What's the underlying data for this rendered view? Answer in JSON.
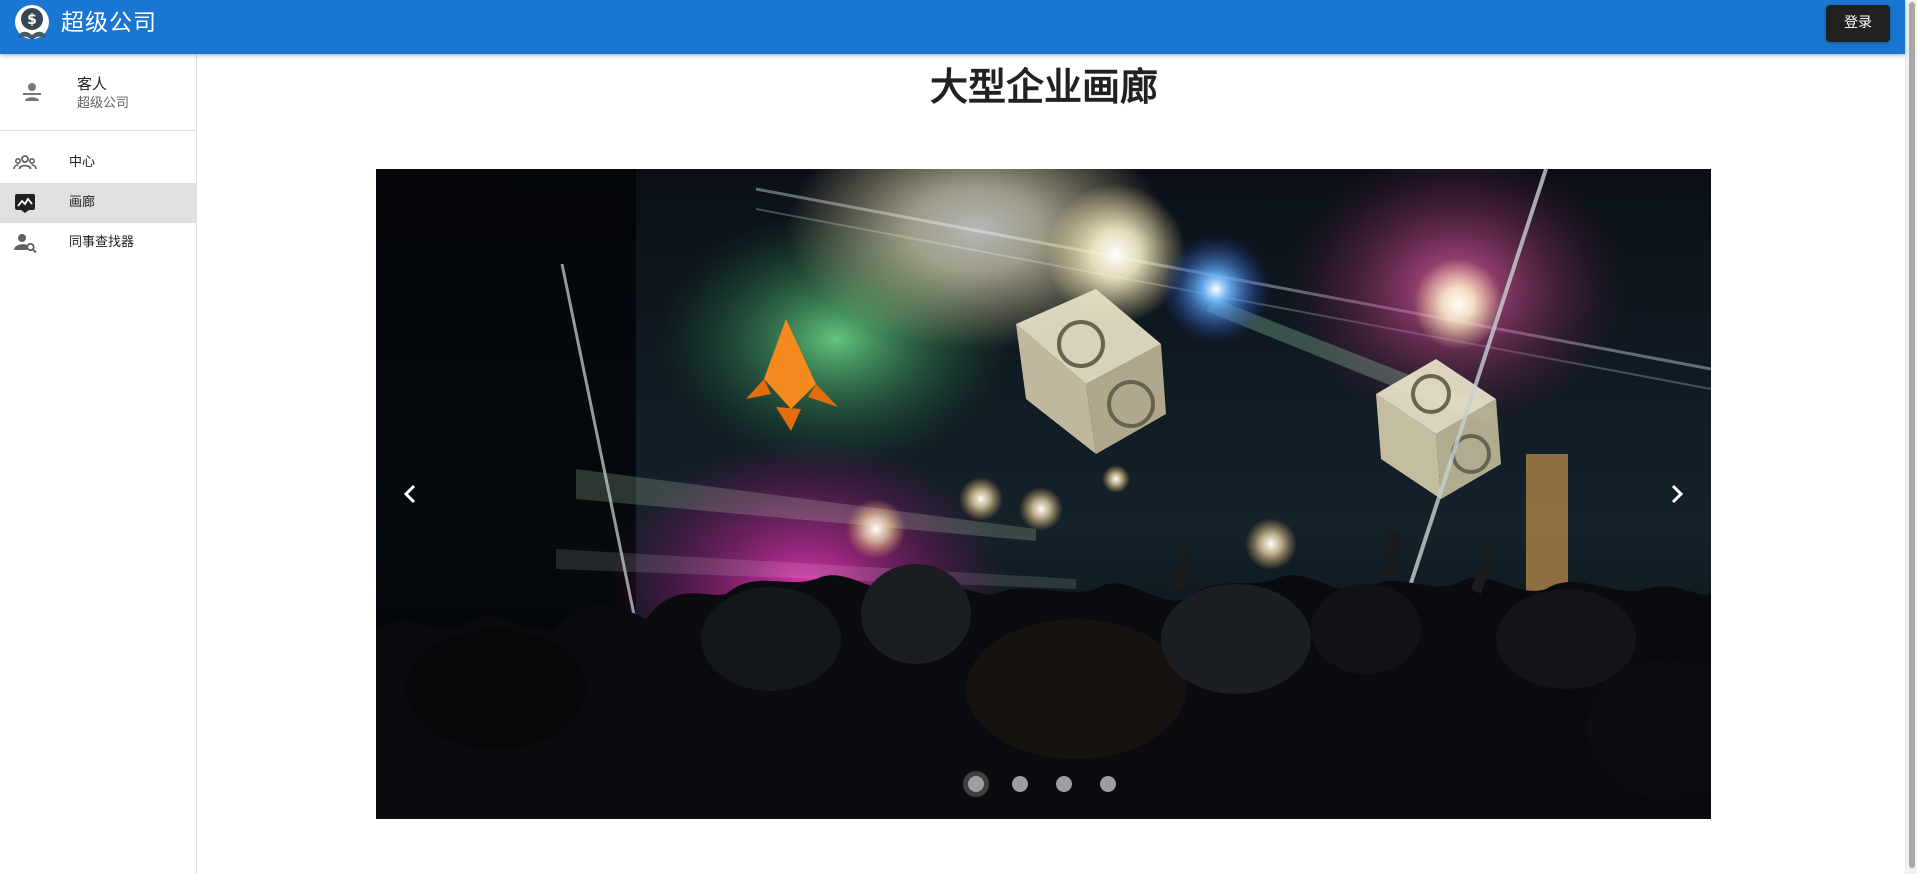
{
  "app": {
    "title": "超级公司",
    "brand_color": "#1976d2"
  },
  "header": {
    "login_label": "登录"
  },
  "user": {
    "name": "客人",
    "company": "超级公司",
    "icon": "person-icon"
  },
  "sidebar": {
    "items": [
      {
        "label": "中心",
        "icon": "group-icon",
        "active": false
      },
      {
        "label": "画廊",
        "icon": "gallery-icon",
        "active": true
      },
      {
        "label": "同事查找器",
        "icon": "person-search-icon",
        "active": false
      }
    ],
    "active_color": "#e0e0e0"
  },
  "main": {
    "title": "大型企业画廊"
  },
  "carousel": {
    "slide_count": 4,
    "active_index": 0,
    "current_slide": "concert crowd with stage lights, inflatable speaker cubes and an orange fish balloon",
    "prev_icon": "chevron-left-icon",
    "next_icon": "chevron-right-icon"
  }
}
